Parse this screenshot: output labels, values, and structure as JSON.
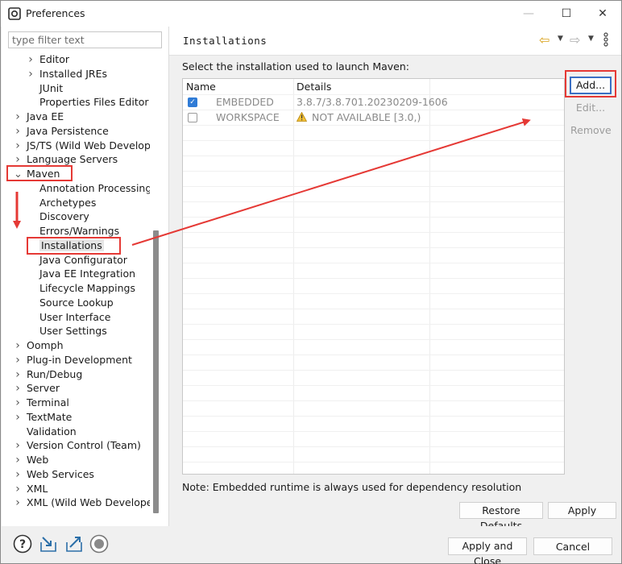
{
  "window": {
    "title": "Preferences",
    "minimize_symbol": "—",
    "maximize_symbol": "☐",
    "close_symbol": "✕"
  },
  "filter": {
    "placeholder": "type filter text",
    "value": ""
  },
  "tree": {
    "items": [
      {
        "label": "Editor",
        "level": 2,
        "expander": "collapsed"
      },
      {
        "label": "Installed JREs",
        "level": 2,
        "expander": "collapsed"
      },
      {
        "label": "JUnit",
        "level": 2,
        "expander": "none"
      },
      {
        "label": "Properties Files Editor",
        "level": 2,
        "expander": "none"
      },
      {
        "label": "Java EE",
        "level": 1,
        "expander": "collapsed"
      },
      {
        "label": "Java Persistence",
        "level": 1,
        "expander": "collapsed"
      },
      {
        "label": "JS/TS (Wild Web Developer)",
        "level": 1,
        "expander": "collapsed"
      },
      {
        "label": "Language Servers",
        "level": 1,
        "expander": "collapsed"
      },
      {
        "label": "Maven",
        "level": 1,
        "expander": "expanded"
      },
      {
        "label": "Annotation Processing",
        "level": 2,
        "expander": "none"
      },
      {
        "label": "Archetypes",
        "level": 2,
        "expander": "none"
      },
      {
        "label": "Discovery",
        "level": 2,
        "expander": "none"
      },
      {
        "label": "Errors/Warnings",
        "level": 2,
        "expander": "none"
      },
      {
        "label": "Installations",
        "level": 2,
        "expander": "none",
        "selected": true
      },
      {
        "label": "Java Configurator",
        "level": 2,
        "expander": "none"
      },
      {
        "label": "Java EE Integration",
        "level": 2,
        "expander": "none"
      },
      {
        "label": "Lifecycle Mappings",
        "level": 2,
        "expander": "none"
      },
      {
        "label": "Source Lookup",
        "level": 2,
        "expander": "none"
      },
      {
        "label": "User Interface",
        "level": 2,
        "expander": "none"
      },
      {
        "label": "User Settings",
        "level": 2,
        "expander": "none"
      },
      {
        "label": "Oomph",
        "level": 1,
        "expander": "collapsed"
      },
      {
        "label": "Plug-in Development",
        "level": 1,
        "expander": "collapsed"
      },
      {
        "label": "Run/Debug",
        "level": 1,
        "expander": "collapsed"
      },
      {
        "label": "Server",
        "level": 1,
        "expander": "collapsed"
      },
      {
        "label": "Terminal",
        "level": 1,
        "expander": "collapsed"
      },
      {
        "label": "TextMate",
        "level": 1,
        "expander": "collapsed"
      },
      {
        "label": "Validation",
        "level": 1,
        "expander": "none"
      },
      {
        "label": "Version Control (Team)",
        "level": 1,
        "expander": "collapsed"
      },
      {
        "label": "Web",
        "level": 1,
        "expander": "collapsed"
      },
      {
        "label": "Web Services",
        "level": 1,
        "expander": "collapsed"
      },
      {
        "label": "XML",
        "level": 1,
        "expander": "collapsed"
      },
      {
        "label": "XML (Wild Web Developer)",
        "level": 1,
        "expander": "collapsed"
      }
    ]
  },
  "page": {
    "title": "Installations",
    "instruction": "Select the installation used to launch Maven:",
    "table": {
      "columns": [
        "Name",
        "Details"
      ],
      "rows": [
        {
          "checked": true,
          "name": "EMBEDDED",
          "details": "3.8.7/3.8.701.20230209-1606",
          "warning": false
        },
        {
          "checked": false,
          "name": "WORKSPACE",
          "details": "NOT AVAILABLE [3.0,)",
          "warning": true
        }
      ]
    },
    "buttons": {
      "add": "Add...",
      "edit": "Edit...",
      "remove": "Remove"
    },
    "note": "Note: Embedded runtime is always used for dependency resolution",
    "restore_defaults": "Restore Defaults",
    "apply": "Apply"
  },
  "footer": {
    "apply_and_close": "Apply and Close",
    "cancel": "Cancel",
    "icons": [
      "help-icon",
      "import-icon",
      "export-icon",
      "record-icon"
    ]
  },
  "colors": {
    "annotation": "#e53935",
    "selection_bg": "#e5e5e5",
    "checkbox_checked": "#2f7bd6",
    "nav_back": "#d9a21b"
  }
}
